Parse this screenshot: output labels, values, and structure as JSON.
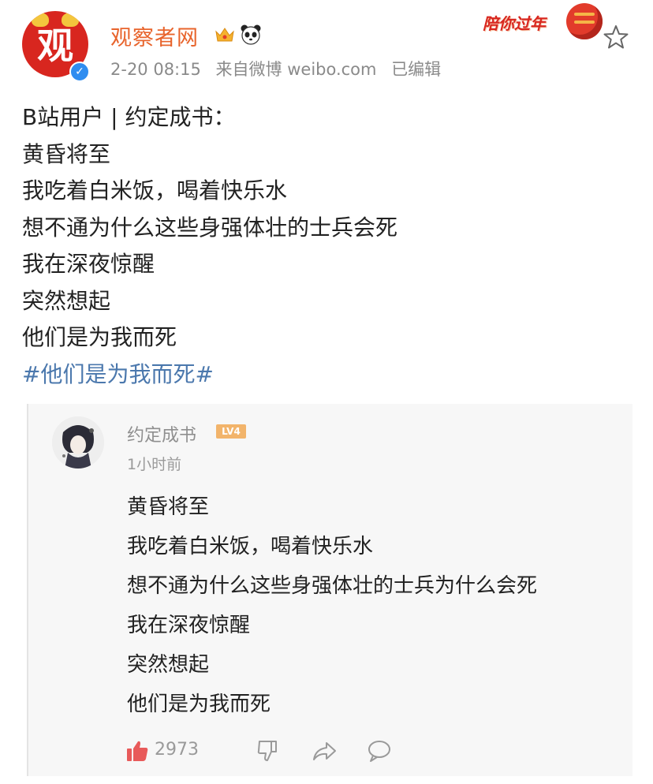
{
  "author": {
    "name": "观察者网",
    "avatar_char": "观",
    "timestamp": "2-20 08:15",
    "source": "来自微博 weibo.com",
    "edited": "已编辑"
  },
  "badges": {
    "newyear_label": "陪你过年"
  },
  "post": {
    "lines": [
      "B站用户 | 约定成书：",
      "黄昏将至",
      "我吃着白米饭，喝着快乐水",
      "想不通为什么这些身强体壮的士兵会死",
      "我在深夜惊醒",
      "突然想起",
      "他们是为我而死"
    ],
    "hashtag": "#他们是为我而死#"
  },
  "quoted_comment": {
    "username": "约定成书",
    "level": "LV4",
    "time": "1小时前",
    "lines": [
      "黄昏将至",
      "我吃着白米饭，喝着快乐水",
      "想不通为什么这些身强体壮的士兵为什么会死",
      "我在深夜惊醒",
      "突然想起",
      "他们是为我而死"
    ],
    "like_count": "2973"
  },
  "icons": {
    "verified": "verified-icon",
    "crown": "crown-icon",
    "panda": "panda-icon",
    "favorite": "star-icon",
    "like": "thumbs-up-icon",
    "dislike": "thumbs-down-icon",
    "share": "share-icon",
    "comment": "comment-icon"
  },
  "colors": {
    "username": "#e8642c",
    "hashtag": "#4b78ad",
    "brand_red": "#d8261f",
    "verified_blue": "#2f8df0",
    "meta_gray": "#8a8a8a",
    "like_red": "#e85a5a"
  }
}
